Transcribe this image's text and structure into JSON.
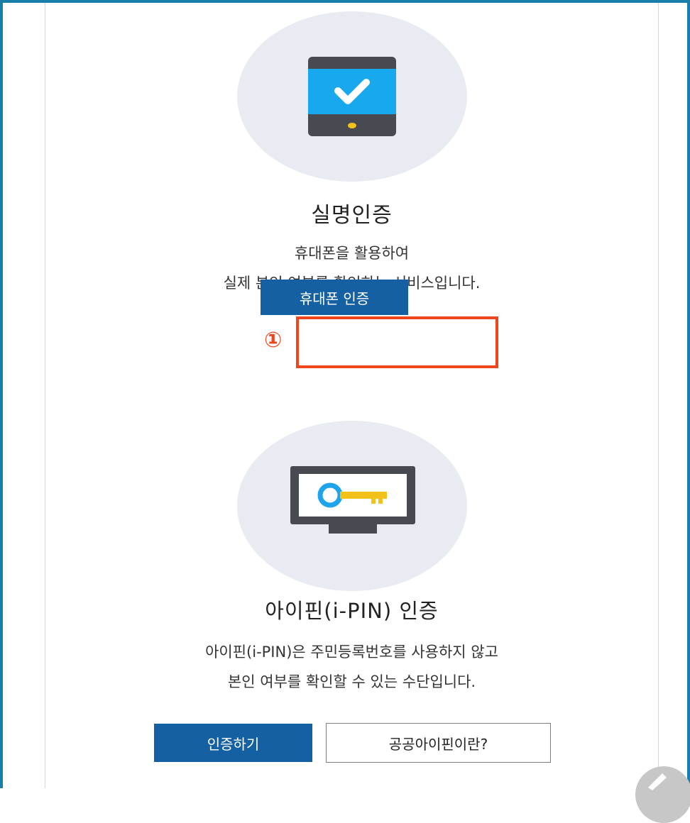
{
  "colors": {
    "frame_border": "#1a7fa8",
    "primary_button": "#155fa3",
    "highlight": "#f0461c",
    "icon_circle": "#e9ebf3",
    "device_body": "#474a50",
    "phone_screen": "#17a8ee",
    "key_circle": "#1fa3ea",
    "key_shaft": "#f2c21a"
  },
  "phone_section": {
    "icon": "smartphone-check-icon",
    "title": "실명인증",
    "description_line1": "휴대폰을 활용하여",
    "description_line2": "실제 본인 여부를 확인하는 서비스입니다.",
    "button_label": "휴대폰 인증",
    "step_marker": "①"
  },
  "ipin_section": {
    "icon": "monitor-key-icon",
    "title": "아이핀(i-PIN) 인증",
    "description_line1": "아이핀(i-PIN)은 주민등록번호를 사용하지 않고",
    "description_line2": "본인 여부를 확인할 수 있는 수단입니다.",
    "primary_button_label": "인증하기",
    "secondary_button_label": "공공아이핀이란?"
  },
  "floating_button": {
    "icon": "pencil-icon"
  }
}
